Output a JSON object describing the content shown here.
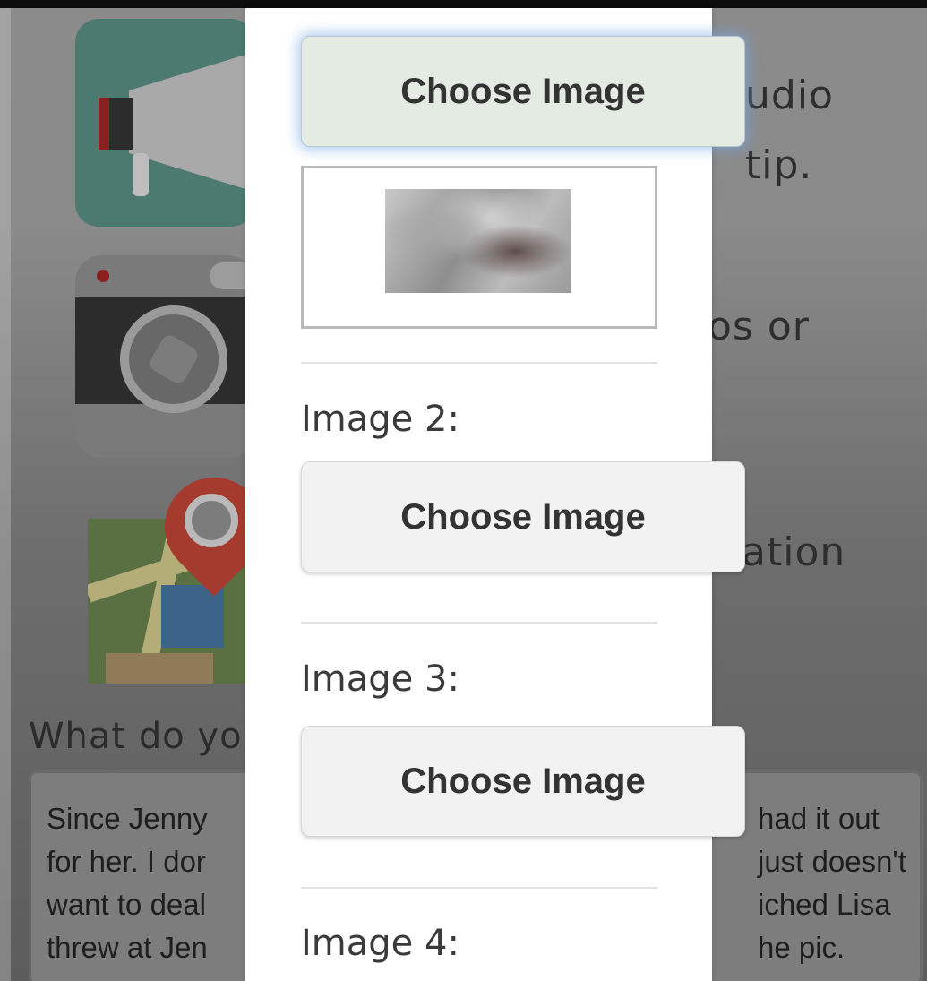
{
  "background": {
    "texts": [
      "udio",
      "tip.",
      "os or",
      "ation"
    ],
    "question_label": "What do yo",
    "answer_left_lines": [
      "Since Jenny",
      "for her. I dor",
      "want to deal",
      "threw at Jen"
    ],
    "answer_right_lines": [
      "had it out",
      "just doesn't",
      "iched Lisa",
      "he pic."
    ],
    "icons": [
      "megaphone-icon",
      "camera-icon",
      "map-pin-icon"
    ]
  },
  "modal": {
    "buttons": [
      {
        "label": "Choose Image",
        "state": "focused"
      },
      {
        "label": "Choose Image",
        "state": "default"
      },
      {
        "label": "Choose Image",
        "state": "default"
      }
    ],
    "image_labels": [
      "Image 2:",
      "Image 3:",
      "Image 4:"
    ],
    "preview": {
      "has_image": true
    }
  },
  "colors": {
    "focused_button_bg": "#e4ebe3",
    "button_bg": "#f2f2f2",
    "focus_glow": "#78aae6"
  }
}
